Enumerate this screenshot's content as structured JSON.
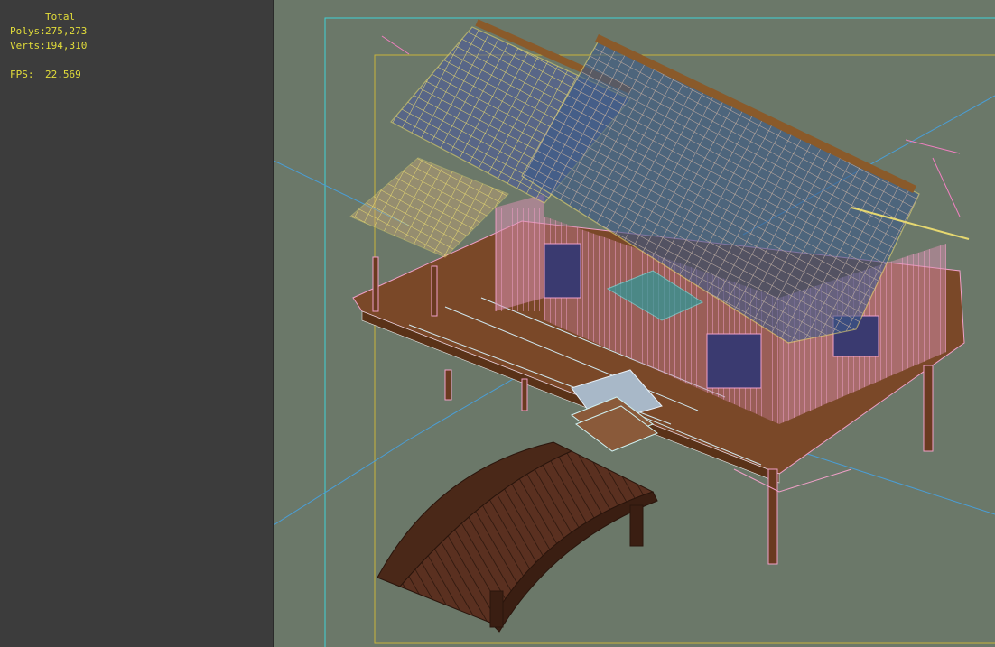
{
  "stats": {
    "total_label": "Total",
    "polys_label": "Polys:",
    "polys_value": "275,273",
    "verts_label": "Verts:",
    "verts_value": "194,310",
    "fps_label": "FPS:",
    "fps_value": "22.569"
  },
  "colors": {
    "panel_bg": "#3c3c3c",
    "viewport_bg": "#6b7869",
    "stat_text": "#e2dd3a",
    "frame_cyan": "#3fd2d6",
    "safe_frame": "#c8b43a",
    "wood": "#7a4828",
    "wire_pink": "#f0a0c8",
    "wire_yellow": "#e0e060",
    "wire_blue": "#5050d0",
    "wire_teal": "#40b0b0",
    "bridge_brown": "#5a3020"
  }
}
